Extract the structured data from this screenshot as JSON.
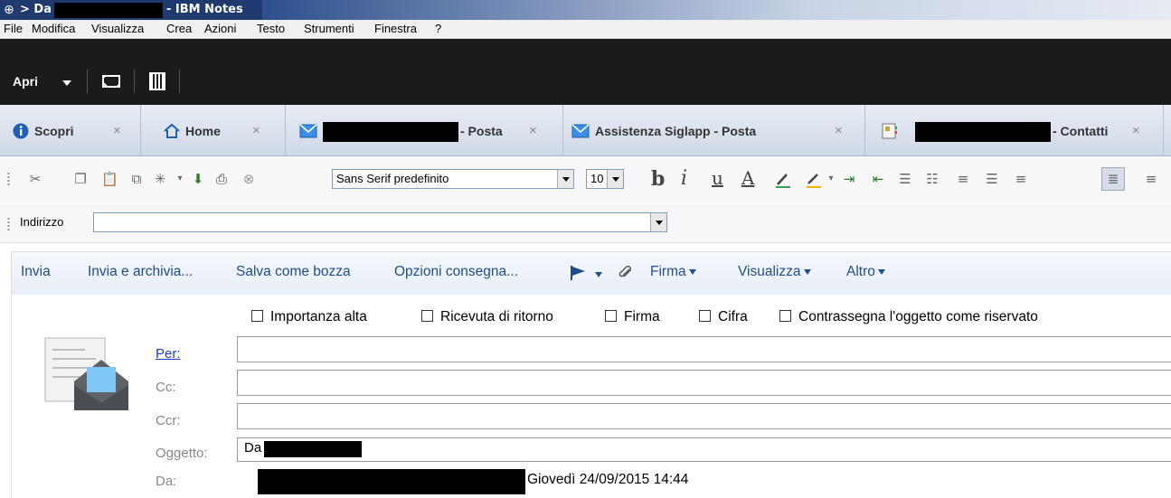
{
  "window": {
    "title_prefix": "> Da",
    "title_suffix": "- IBM Notes"
  },
  "menu": [
    "File",
    "Modifica",
    "Visualizza",
    "Crea",
    "Azioni",
    "Testo",
    "Strumenti",
    "Finestra",
    "?"
  ],
  "actionbar": {
    "open_label": "Apri"
  },
  "tabs": [
    {
      "label": "Scopri",
      "icon": "info-icon"
    },
    {
      "label": "Home",
      "icon": "home-icon"
    },
    {
      "label": "- Posta",
      "icon": "mail-icon"
    },
    {
      "label": "Assistenza Siglapp - Posta",
      "icon": "mail-icon"
    },
    {
      "label": "- Contatti",
      "icon": "contacts-icon"
    }
  ],
  "tab_close": "×",
  "format": {
    "font": "Sans Serif predefinito",
    "size": "10",
    "bold": "b",
    "italic": "i",
    "underline": "u",
    "color": "A"
  },
  "address": {
    "label": "Indirizzo",
    "value": ""
  },
  "mail_actions": {
    "send": "Invia",
    "send_archive": "Invia e archivia...",
    "save_draft": "Salva come bozza",
    "delivery_options": "Opzioni consegna...",
    "signature": "Firma",
    "view": "Visualizza",
    "more": "Altro"
  },
  "options": {
    "high_importance": "Importanza alta",
    "return_receipt": "Ricevuta di ritorno",
    "sign": "Firma",
    "encrypt": "Cifra",
    "confidential": "Contrassegna l'oggetto come riservato"
  },
  "fields": {
    "to_label": "Per:",
    "cc_label": "Cc:",
    "bcc_label": "Ccr:",
    "subject_label": "Oggetto:",
    "subject_value": "Da",
    "from_label": "Da:",
    "date_value": "Giovedì 24/09/2015 14:44"
  },
  "colors": {
    "title_bar": "#1f3a6e",
    "action_bar": "#1b1b1b",
    "link_blue": "#1f4e8c",
    "field_link": "#1a3cc8"
  }
}
